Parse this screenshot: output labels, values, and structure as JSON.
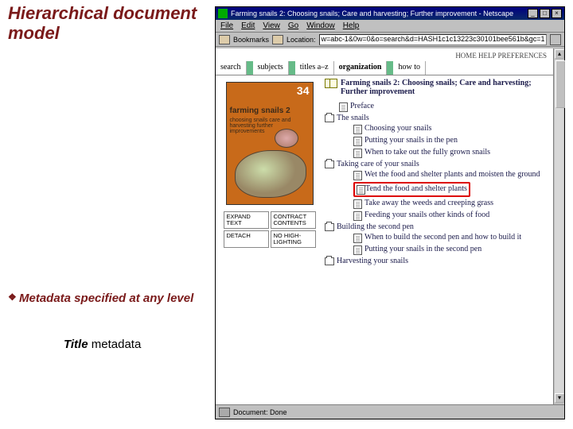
{
  "slide": {
    "heading": "Hierarchical document model",
    "bullet": "Metadata specified at any level",
    "title_em": "Title",
    "title_rest": "metadata"
  },
  "browser": {
    "window_title": "Farming snails 2: Choosing snails; Care and harvesting; Further improvement - Netscape",
    "menus": [
      "File",
      "Edit",
      "View",
      "Go",
      "Window",
      "Help"
    ],
    "bookmarks_label": "Bookmarks",
    "location_label": "Location:",
    "location_value": "w=abc-1&0w=0&o=search&d=HASH1c1c13223c30101bee561b&gc=1",
    "status": "Document: Done",
    "top_links": "HOME HELP PREFERENCES",
    "tabs": [
      "search",
      "subjects",
      "titles a–z",
      "organization",
      "how to"
    ],
    "active_tab_index": 3
  },
  "cover": {
    "number": "34",
    "title": "farming snails 2",
    "subtitle": "choosing snails\ncare and harvesting\nfurther improvements"
  },
  "buttons": {
    "b0": "EXPAND TEXT",
    "b1": "CONTRACT CONTENTS",
    "b2": "DETACH",
    "b3": "NO HIGH-LIGHTING"
  },
  "tree": {
    "root": "Farming snails 2: Choosing snails; Care and harvesting; Further improvement",
    "items": [
      {
        "type": "leaf",
        "label": "Preface"
      },
      {
        "type": "node",
        "label": "The snails",
        "children": [
          {
            "label": "Choosing your snails"
          },
          {
            "label": "Putting your snails in the pen"
          },
          {
            "label": "When to take out the fully grown snails"
          }
        ]
      },
      {
        "type": "node",
        "label": "Taking care of your snails",
        "children": [
          {
            "label": "Wet the food and shelter plants and moisten the ground"
          },
          {
            "label": "Tend the food and shelter plants",
            "highlight": true
          },
          {
            "label": "Take away the weeds and creeping grass"
          },
          {
            "label": "Feeding your snails other kinds of food"
          }
        ]
      },
      {
        "type": "node",
        "label": "Building the second pen",
        "children": [
          {
            "label": "When to build the second pen and how to build it"
          },
          {
            "label": "Putting your snails in the second pen"
          }
        ]
      },
      {
        "type": "node",
        "label": "Harvesting your snails",
        "children": []
      }
    ]
  }
}
